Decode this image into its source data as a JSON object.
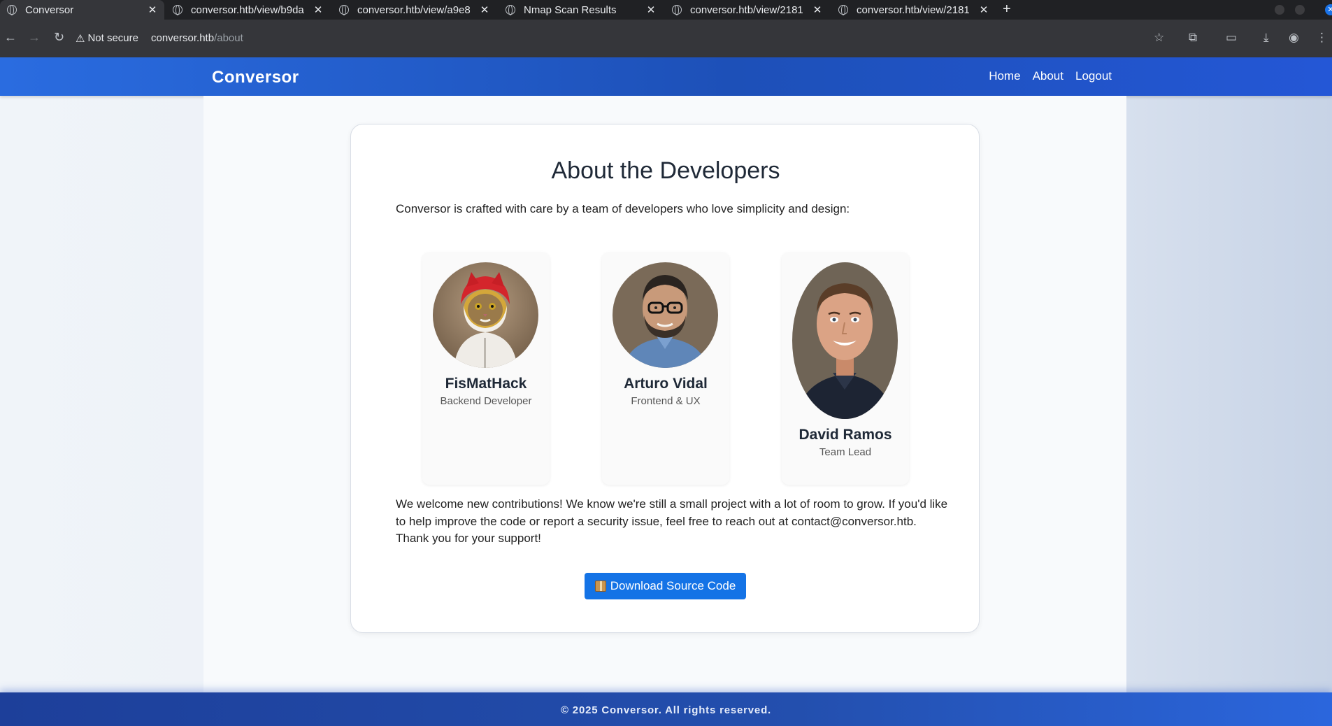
{
  "browser": {
    "tabs": [
      {
        "title": "Conversor",
        "active": true
      },
      {
        "title": "conversor.htb/view/b9da",
        "active": false
      },
      {
        "title": "conversor.htb/view/a9e8",
        "active": false
      },
      {
        "title": "Nmap Scan Results",
        "active": false
      },
      {
        "title": "conversor.htb/view/2181",
        "active": false
      },
      {
        "title": "conversor.htb/view/2181",
        "active": false
      }
    ],
    "security_label": "Not secure",
    "url_host": "conversor.htb",
    "url_path": "/about"
  },
  "navbar": {
    "brand": "Conversor",
    "links": [
      "Home",
      "About",
      "Logout"
    ]
  },
  "about": {
    "heading": "About the Developers",
    "intro": "Conversor is crafted with care by a team of developers who love simplicity and design:",
    "developers": [
      {
        "name": "FisMatHack",
        "role": "Backend Developer",
        "avatar": "cat-in-red-hood-avatar"
      },
      {
        "name": "Arturo Vidal",
        "role": "Frontend & UX",
        "avatar": "man-with-glasses-avatar"
      },
      {
        "name": "David Ramos",
        "role": "Team Lead",
        "avatar": "smiling-man-avatar"
      }
    ],
    "welcome": "We welcome new contributions! We know we're still a small project with a lot of room to grow. If you'd like to help improve the code or report a security issue, feel free to reach out at contact@conversor.htb. Thank you for your support!",
    "download_button": "Download Source Code",
    "download_icon": "package-icon"
  },
  "footer": {
    "text": "© 2025 Conversor. All rights reserved."
  },
  "colors": {
    "navbar": "#2a6ce0",
    "button": "#1473e6",
    "footer": "#234fae"
  }
}
